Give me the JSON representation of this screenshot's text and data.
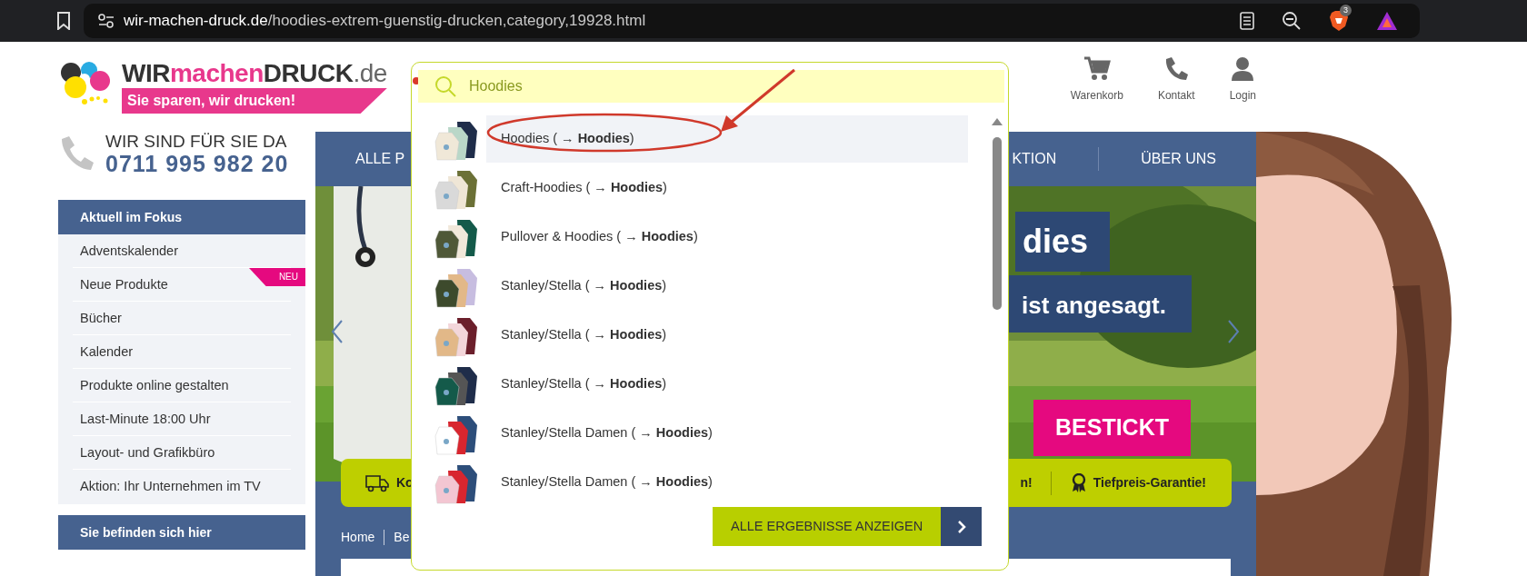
{
  "browser": {
    "url_domain": "wir-machen-druck.de",
    "url_path": "/hoodies-extrem-guenstig-drucken,category,19928.html",
    "shield_badge": "3"
  },
  "header": {
    "logo_parts": [
      {
        "text": "WIR",
        "kind": "dark"
      },
      {
        "text": "machen",
        "kind": "accent"
      },
      {
        "text": "DRUCK",
        "kind": "dark"
      },
      {
        "text": ".de",
        "kind": "tld"
      }
    ],
    "tagline": "Sie sparen, wir drucken!",
    "links": [
      {
        "label": "Warenkorb",
        "kind": "cart"
      },
      {
        "label": "Kontakt",
        "kind": "phone"
      },
      {
        "label": "Login",
        "kind": "user"
      }
    ]
  },
  "hotline": {
    "heading": "WIR SIND FÜR SIE DA",
    "number": "0711 995 982 20"
  },
  "sidebar": [
    {
      "title": "Aktuell im Fokus",
      "items": [
        {
          "label": "Adventskalender"
        },
        {
          "label": "Neue Produkte",
          "badge": "NEU"
        },
        {
          "label": "Bücher"
        },
        {
          "label": "Kalender"
        },
        {
          "label": "Produkte online gestalten"
        },
        {
          "label": "Last-Minute 18:00 Uhr"
        },
        {
          "label": "Layout- und Grafikbüro"
        },
        {
          "label": "Aktion: Ihr Unternehmen im TV"
        }
      ]
    },
    {
      "title": "Sie befinden sich hier"
    }
  ],
  "nav": {
    "left": "ALLE P",
    "right": [
      "KTION",
      "ÜBER UNS"
    ]
  },
  "banner": {
    "headline": "dies",
    "subline": "ist angesagt.",
    "cta": "BESTICKT"
  },
  "features": [
    {
      "kind": "truck",
      "label": "Ko"
    },
    {
      "kind": "plain",
      "label": "n!"
    },
    {
      "kind": "award",
      "label": "Tiefpreis-Garantie!"
    }
  ],
  "breadcrumb": [
    "Home",
    "Be"
  ],
  "search": {
    "value": "Hoodies",
    "results": [
      {
        "label": "Hoodies ( → **Hoodies**)",
        "selected": true
      },
      {
        "label": "Craft-Hoodies ( → **Hoodies**)",
        "selected": false
      },
      {
        "label": "Pullover & Hoodies ( → **Hoodies**)",
        "selected": false
      },
      {
        "label": "Stanley/Stella ( → **Hoodies**)",
        "selected": false
      },
      {
        "label": "Stanley/Stella ( → **Hoodies**)",
        "selected": false
      },
      {
        "label": "Stanley/Stella ( → **Hoodies**)",
        "selected": false
      },
      {
        "label": "Stanley/Stella Damen ( → **Hoodies**)",
        "selected": false
      },
      {
        "label": "Stanley/Stella Damen ( → **Hoodies**)",
        "selected": false
      }
    ],
    "all_button": "ALLE ERGEBNISSE ANZEIGEN"
  }
}
